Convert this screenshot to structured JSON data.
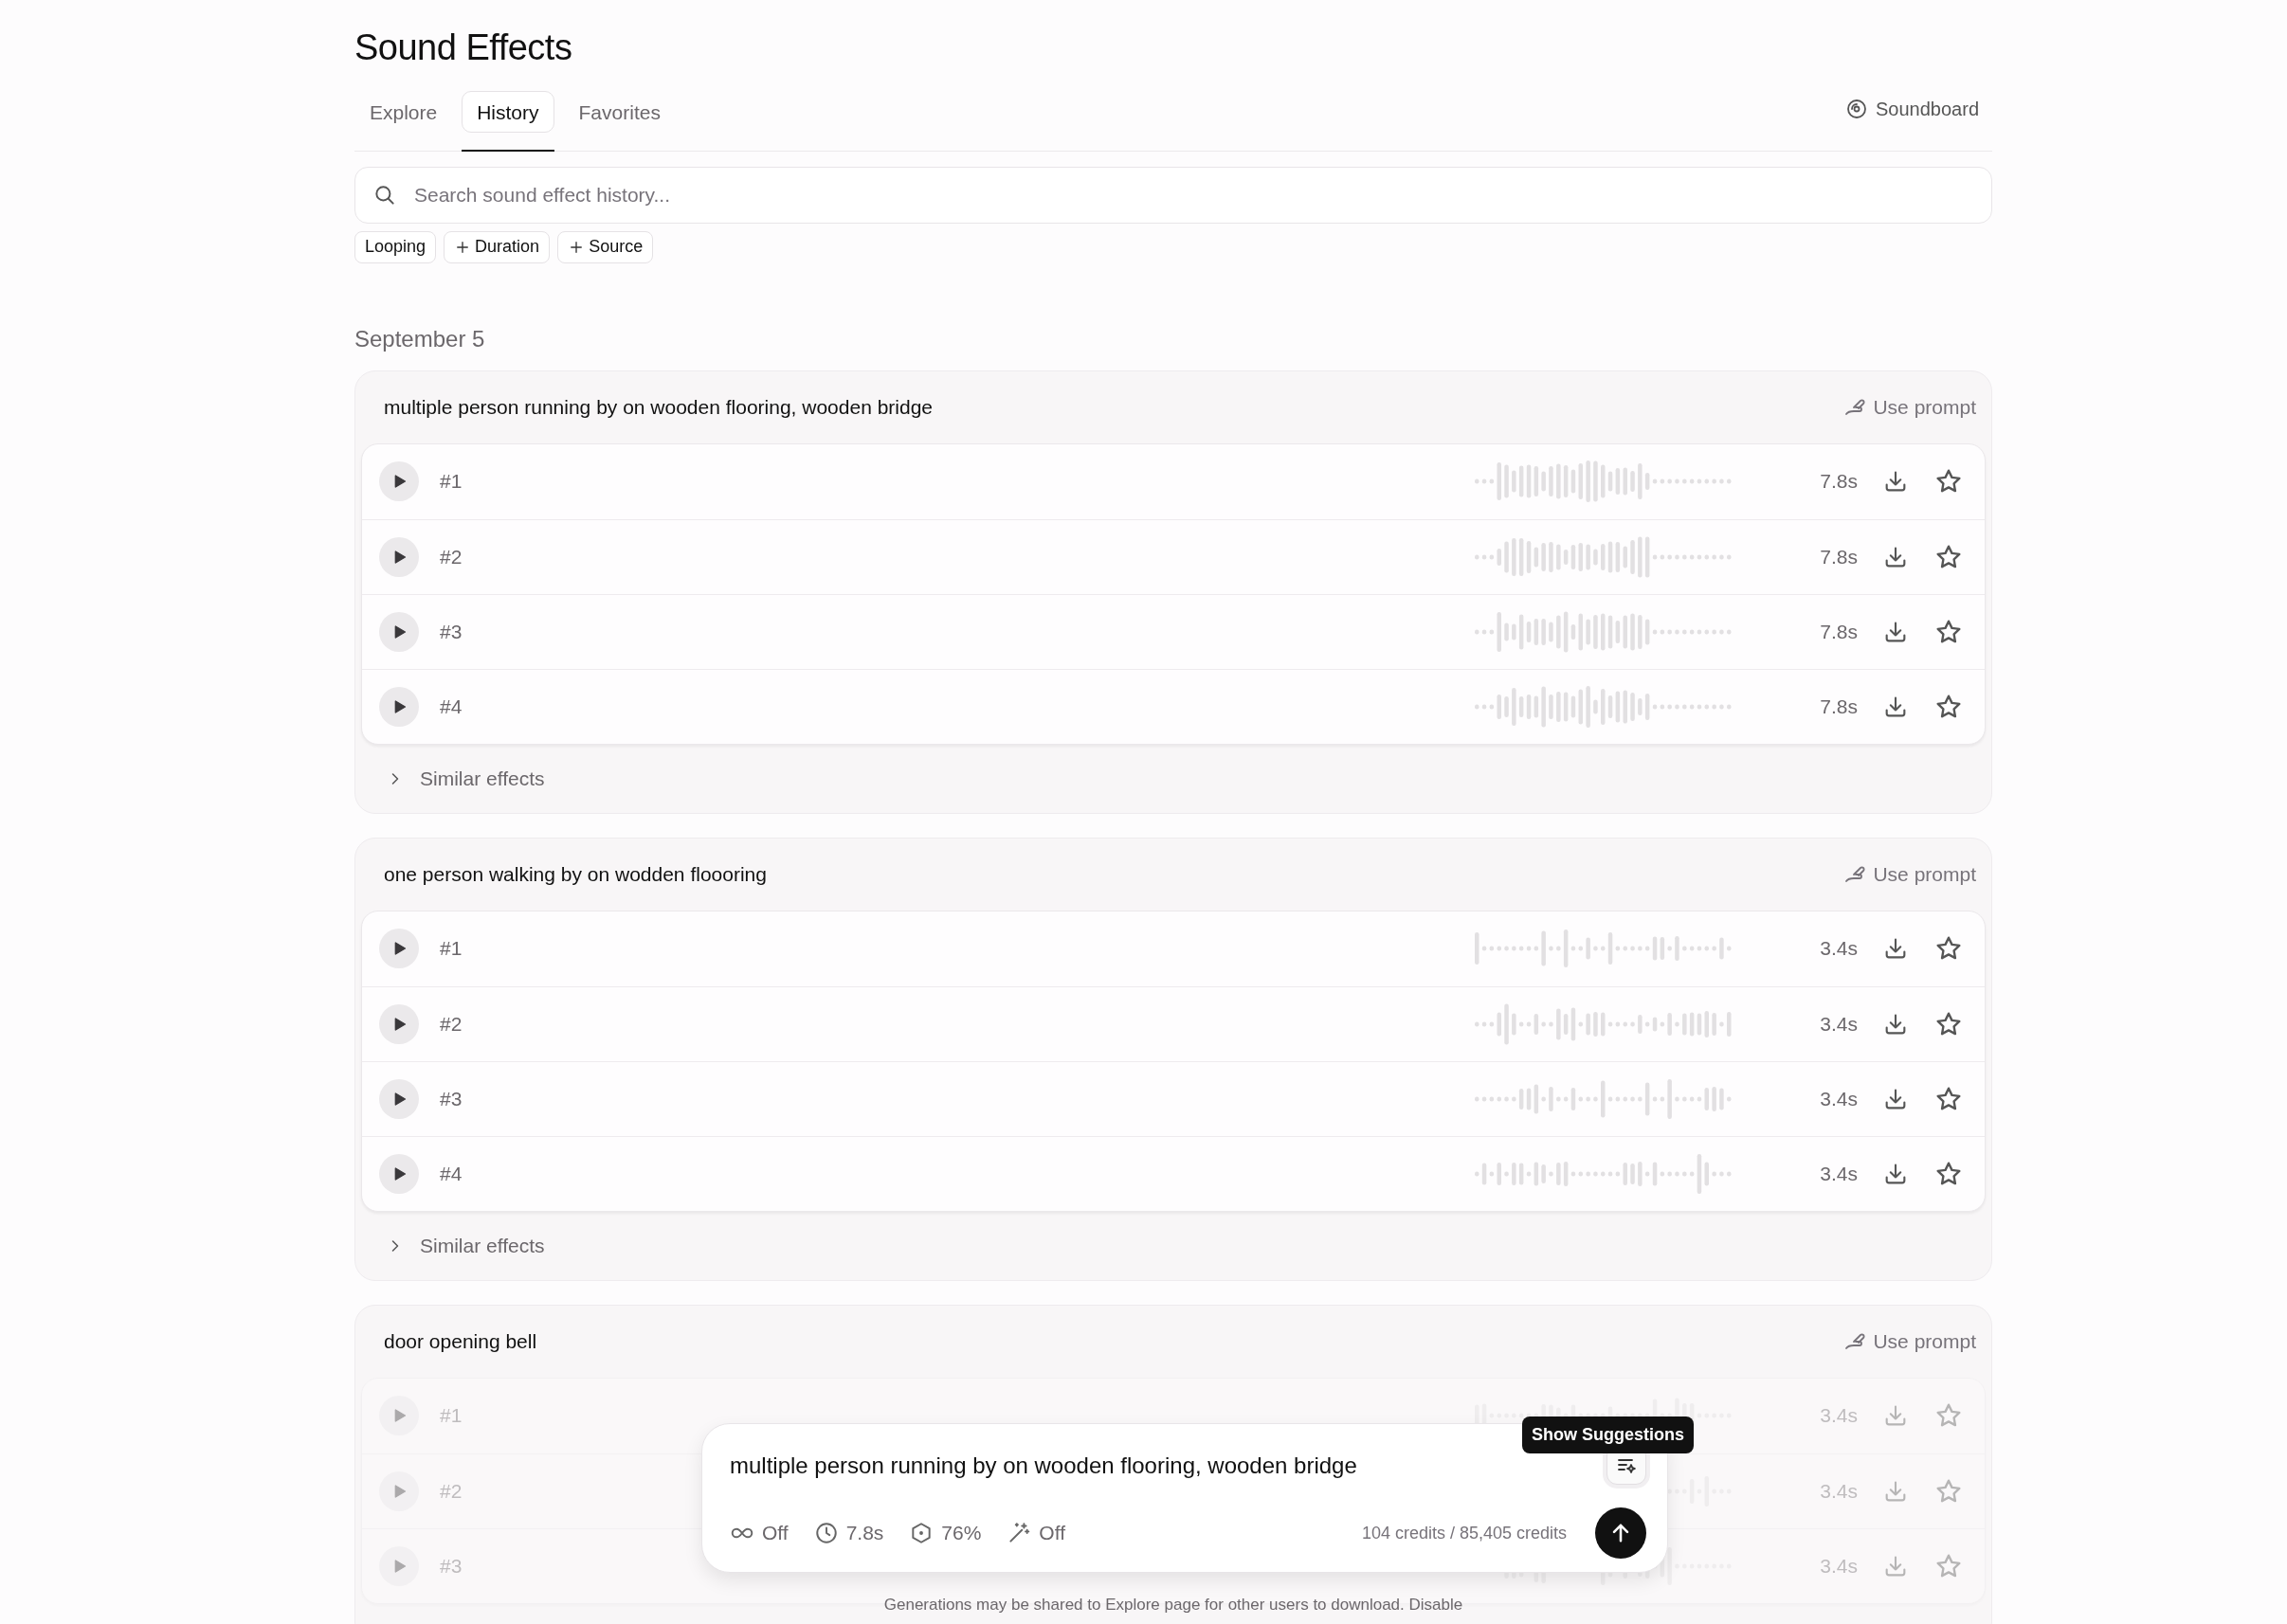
{
  "page": {
    "title": "Sound Effects"
  },
  "tabs": [
    {
      "label": "Explore",
      "selected": false
    },
    {
      "label": "History",
      "selected": true
    },
    {
      "label": "Favorites",
      "selected": false
    }
  ],
  "soundboard": {
    "label": "Soundboard"
  },
  "search": {
    "placeholder": "Search sound effect history..."
  },
  "filters": [
    {
      "label": "Looping",
      "kind": "toggle"
    },
    {
      "label": "Duration",
      "kind": "add"
    },
    {
      "label": "Source",
      "kind": "add"
    }
  ],
  "date_heading": "September 5",
  "groups": [
    {
      "prompt": "multiple person running by on wooden flooring, wooden bridge",
      "use_prompt": "Use prompt",
      "dimmed": false,
      "variants": [
        {
          "label": "#1",
          "duration": "7.8s"
        },
        {
          "label": "#2",
          "duration": "7.8s"
        },
        {
          "label": "#3",
          "duration": "7.8s"
        },
        {
          "label": "#4",
          "duration": "7.8s"
        }
      ],
      "similar": "Similar effects"
    },
    {
      "prompt": "one person walking by on wodden floooring",
      "use_prompt": "Use prompt",
      "dimmed": false,
      "variants": [
        {
          "label": "#1",
          "duration": "3.4s"
        },
        {
          "label": "#2",
          "duration": "3.4s"
        },
        {
          "label": "#3",
          "duration": "3.4s"
        },
        {
          "label": "#4",
          "duration": "3.4s"
        }
      ],
      "similar": "Similar effects"
    },
    {
      "prompt": "door opening bell",
      "use_prompt": "Use prompt",
      "dimmed": true,
      "variants": [
        {
          "label": "#1",
          "duration": "3.4s"
        },
        {
          "label": "#2",
          "duration": "3.4s"
        },
        {
          "label": "#3",
          "duration": "3.4s"
        }
      ]
    }
  ],
  "composer": {
    "prompt": "multiple person running by on wooden flooring, wooden bridge",
    "tooltip": "Show Suggestions",
    "settings": [
      {
        "kind": "loop",
        "value": "Off"
      },
      {
        "kind": "duration",
        "value": "7.8s"
      },
      {
        "kind": "influence",
        "value": "76%"
      },
      {
        "kind": "enhance",
        "value": "Off"
      }
    ],
    "credits": "104 credits / 85,405 credits"
  },
  "footer": {
    "text": "Generations may be shared to Explore page for other users to download.",
    "link": "Disable"
  }
}
